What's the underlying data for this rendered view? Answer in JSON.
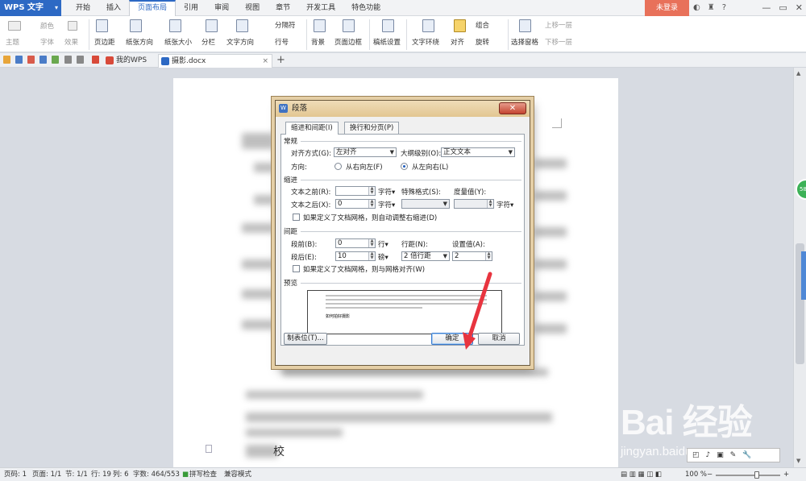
{
  "app": {
    "name": "WPS 文字"
  },
  "menu": {
    "tabs": [
      "开始",
      "插入",
      "页面布局",
      "引用",
      "审阅",
      "视图",
      "章节",
      "开发工具",
      "特色功能"
    ],
    "active": "页面布局",
    "login_label": "未登录"
  },
  "ribbon": {
    "theme": "主题",
    "color": "颜色",
    "font": "字体",
    "effect": "效果",
    "margins": "页边距",
    "orientation": "纸张方向",
    "size": "纸张大小",
    "columns": "分栏",
    "text_direction": "文字方向",
    "breaks": "分隔符",
    "line_numbers": "行号",
    "background": "背景",
    "page_border": "页面边框",
    "draft_settings": "稿纸设置",
    "text_wrap": "文字环绕",
    "align": "对齐",
    "group": "组合",
    "rotate": "旋转",
    "selection_pane": "选择窗格",
    "bring_forward": "上移一层",
    "send_backward": "下移一层"
  },
  "doc_tabs": [
    {
      "label": "我的WPS"
    },
    {
      "label": "摄影.docx"
    }
  ],
  "dialog": {
    "title": "段落",
    "tabs": [
      "缩进和间距(I)",
      "换行和分页(P)"
    ],
    "general": {
      "section": "常规",
      "alignment_label": "对齐方式(G):",
      "alignment_value": "左对齐",
      "outline_label": "大纲级别(O):",
      "outline_value": "正文文本",
      "direction_label": "方向:",
      "rtl_label": "从右向左(F)",
      "ltr_label": "从左向右(L)"
    },
    "indent": {
      "section": "缩进",
      "before_label": "文本之前(R):",
      "before_value": "",
      "before_unit": "字符▾",
      "special_label": "特殊格式(S):",
      "special_value": "",
      "by_label": "度量值(Y):",
      "by_value": "",
      "by_unit": "字符▾",
      "after_label": "文本之后(X):",
      "after_value": "0",
      "after_unit": "字符▾",
      "grid_check": "如果定义了文档网格，则自动调整右缩进(D)"
    },
    "spacing": {
      "section": "间距",
      "before_label": "段前(B):",
      "before_value": "0",
      "before_unit": "行▾",
      "after_label": "段后(E):",
      "after_value": "10",
      "after_unit": "磅▾",
      "line_label": "行距(N):",
      "line_value": "2 倍行距",
      "at_label": "设置值(A):",
      "at_value": "2",
      "grid_check": "如果定义了文档网格，则与网格对齐(W)"
    },
    "preview": {
      "section": "预览",
      "sample": "如何拍好摄影"
    },
    "buttons": {
      "tabs": "制表位(T)...",
      "ok": "确定",
      "cancel": "取消"
    }
  },
  "page_text": {
    "last_char": "校"
  },
  "watermark": {
    "logo": "Bai 经验",
    "url": "jingyan.baidu.com"
  },
  "statusbar": {
    "page_num": "页码: 1",
    "pages": "页面: 1/1",
    "section": "节: 1/1",
    "row": "行: 19",
    "col": "列: 6",
    "word_count": "字数: 464/553",
    "spell": "拼写检查",
    "compat": "兼容模式",
    "zoom": "100 %"
  },
  "colors": {
    "accent": "#2d69c4",
    "login": "#e8715a",
    "arrow": "#e8343f"
  }
}
